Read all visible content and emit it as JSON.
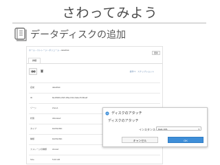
{
  "slide": {
    "title": "さわってみよう",
    "heading": "データディスクの追加"
  },
  "screen": {
    "breadcrumb": "ホーム › ストレージ › ボリューム ›",
    "breadcrumb_current": "dataDisk",
    "top_button": "更新",
    "tab_label": "詳細",
    "action_link": "操作 ▾　スナップショット",
    "rows": [
      {
        "key": "名前",
        "value": "dataDisk"
      },
      {
        "key": "ID",
        "value": "8e4fb9f0-c82f-4f6a-bf1d-9abe7fc9ba2f"
      },
      {
        "key": "ゾーン",
        "value": "Zone1"
      },
      {
        "key": "状態",
        "value": "Allocated"
      },
      {
        "key": "タイプ",
        "value": "DATADISK"
      },
      {
        "key": "種類",
        "value": "DATADISK"
      },
      {
        "key": "ストレージの種類",
        "value": "shared"
      },
      {
        "key": "Size",
        "value": "5.00 GB"
      }
    ]
  },
  "dialog": {
    "title": "ディスクのアタッチ",
    "subtitle": "ディスクのアタッチ",
    "instance_label": "インスタンス:",
    "instance_value": "Rails VM1",
    "cancel_label": "キャンセル",
    "ok_label": "OK"
  }
}
